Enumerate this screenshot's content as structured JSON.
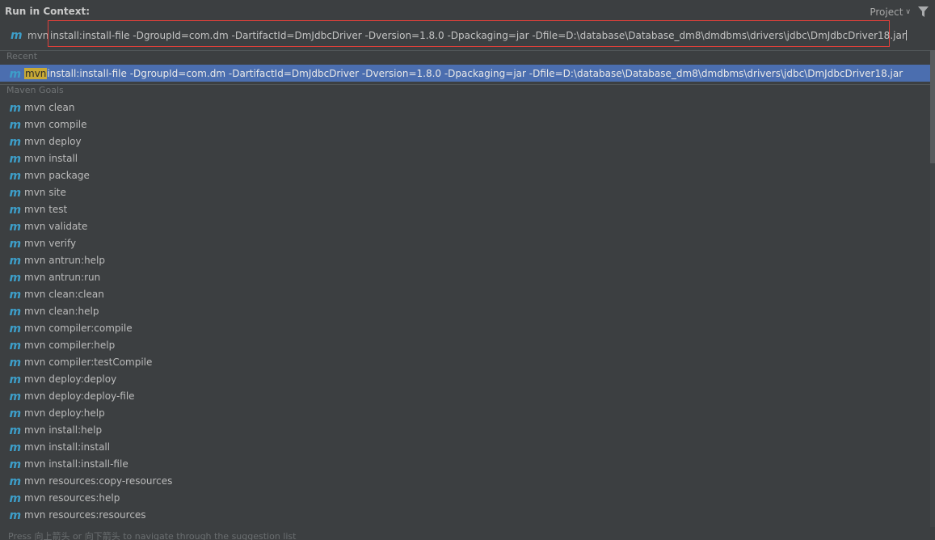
{
  "header": {
    "title": "Run in Context:",
    "scope_label": "Project",
    "scope_icon": "chevron-down-icon",
    "filter_icon": "filter-icon"
  },
  "input": {
    "prefix": "mvn",
    "value": "install:install-file -DgroupId=com.dm -DartifactId=DmJdbcDriver -Dversion=1.8.0 -Dpackaging=jar -Dfile=D:\\database\\Database_dm8\\dmdbms\\drivers\\jdbc\\DmJdbcDriver18.jar",
    "icon": "maven-icon"
  },
  "recent": {
    "label": "Recent",
    "items": [
      {
        "highlight": "mvn",
        "rest": "install:install-file -DgroupId=com.dm -DartifactId=DmJdbcDriver -Dversion=1.8.0 -Dpackaging=jar -Dfile=D:\\database\\Database_dm8\\dmdbms\\drivers\\jdbc\\DmJdbcDriver18.jar"
      }
    ]
  },
  "goals": {
    "label": "Maven Goals",
    "items": [
      "mvn clean",
      "mvn compile",
      "mvn deploy",
      "mvn install",
      "mvn package",
      "mvn site",
      "mvn test",
      "mvn validate",
      "mvn verify",
      "mvn antrun:help",
      "mvn antrun:run",
      "mvn clean:clean",
      "mvn clean:help",
      "mvn compiler:compile",
      "mvn compiler:help",
      "mvn compiler:testCompile",
      "mvn deploy:deploy",
      "mvn deploy:deploy-file",
      "mvn deploy:help",
      "mvn install:help",
      "mvn install:install",
      "mvn install:install-file",
      "mvn resources:copy-resources",
      "mvn resources:help",
      "mvn resources:resources"
    ]
  },
  "status": "Press 向上箭头 or 向下箭头 to navigate through the suggestion list",
  "colors": {
    "background": "#3c3f41",
    "selection": "#4b6eaf",
    "maven_icon": "#3d9ec9",
    "highlight": "#c7a936",
    "input_border": "#e0403a"
  }
}
